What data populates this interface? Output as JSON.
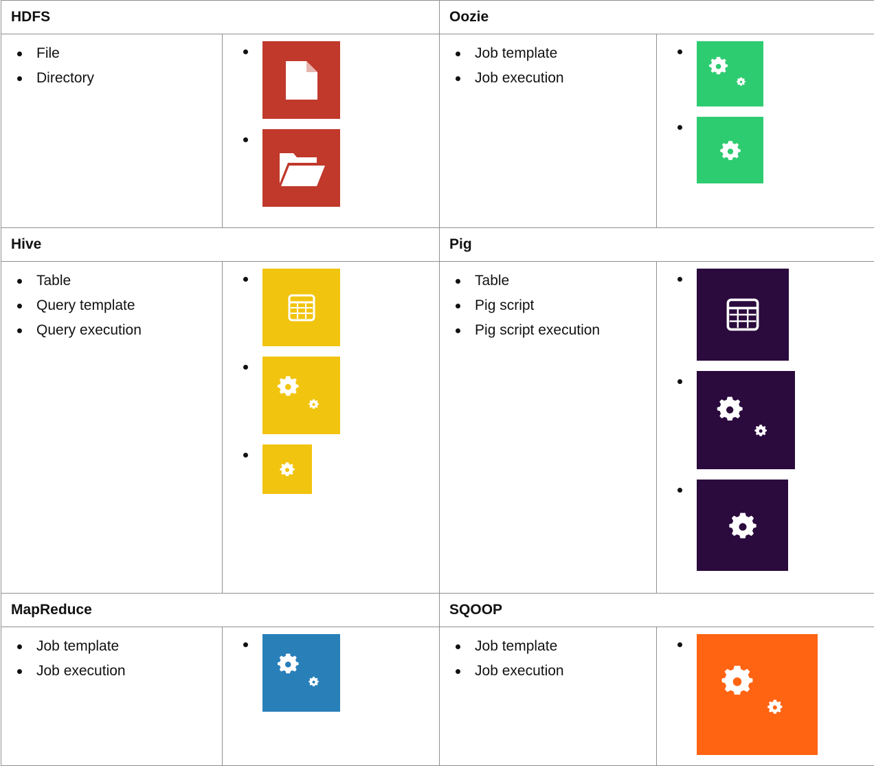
{
  "colors": {
    "hdfs": "#c0392b",
    "oozie": "#2ecc71",
    "hive": "#f1c40f",
    "pig": "#2b0a3d",
    "mapreduce": "#2980b9",
    "sqoop": "#ff6413"
  },
  "sections": {
    "hdfs": {
      "title": "HDFS",
      "items": [
        "File",
        "Directory"
      ],
      "icons": [
        "file-icon",
        "folder-open-icon"
      ]
    },
    "oozie": {
      "title": "Oozie",
      "items": [
        "Job template",
        "Job execution"
      ],
      "icons": [
        "gears-icon",
        "gear-icon"
      ]
    },
    "hive": {
      "title": "Hive",
      "items": [
        "Table",
        "Query template",
        "Query execution"
      ],
      "icons": [
        "table-icon",
        "gears-icon",
        "gear-icon"
      ]
    },
    "pig": {
      "title": "Pig",
      "items": [
        "Table",
        "Pig script",
        "Pig script execution"
      ],
      "icons": [
        "table-icon",
        "gears-icon",
        "gear-icon"
      ]
    },
    "mapreduce": {
      "title": "MapReduce",
      "items": [
        "Job template",
        "Job execution"
      ],
      "icons": [
        "gears-icon"
      ]
    },
    "sqoop": {
      "title": "SQOOP",
      "items": [
        "Job template",
        "Job execution"
      ],
      "icons": [
        "gears-icon"
      ]
    }
  }
}
